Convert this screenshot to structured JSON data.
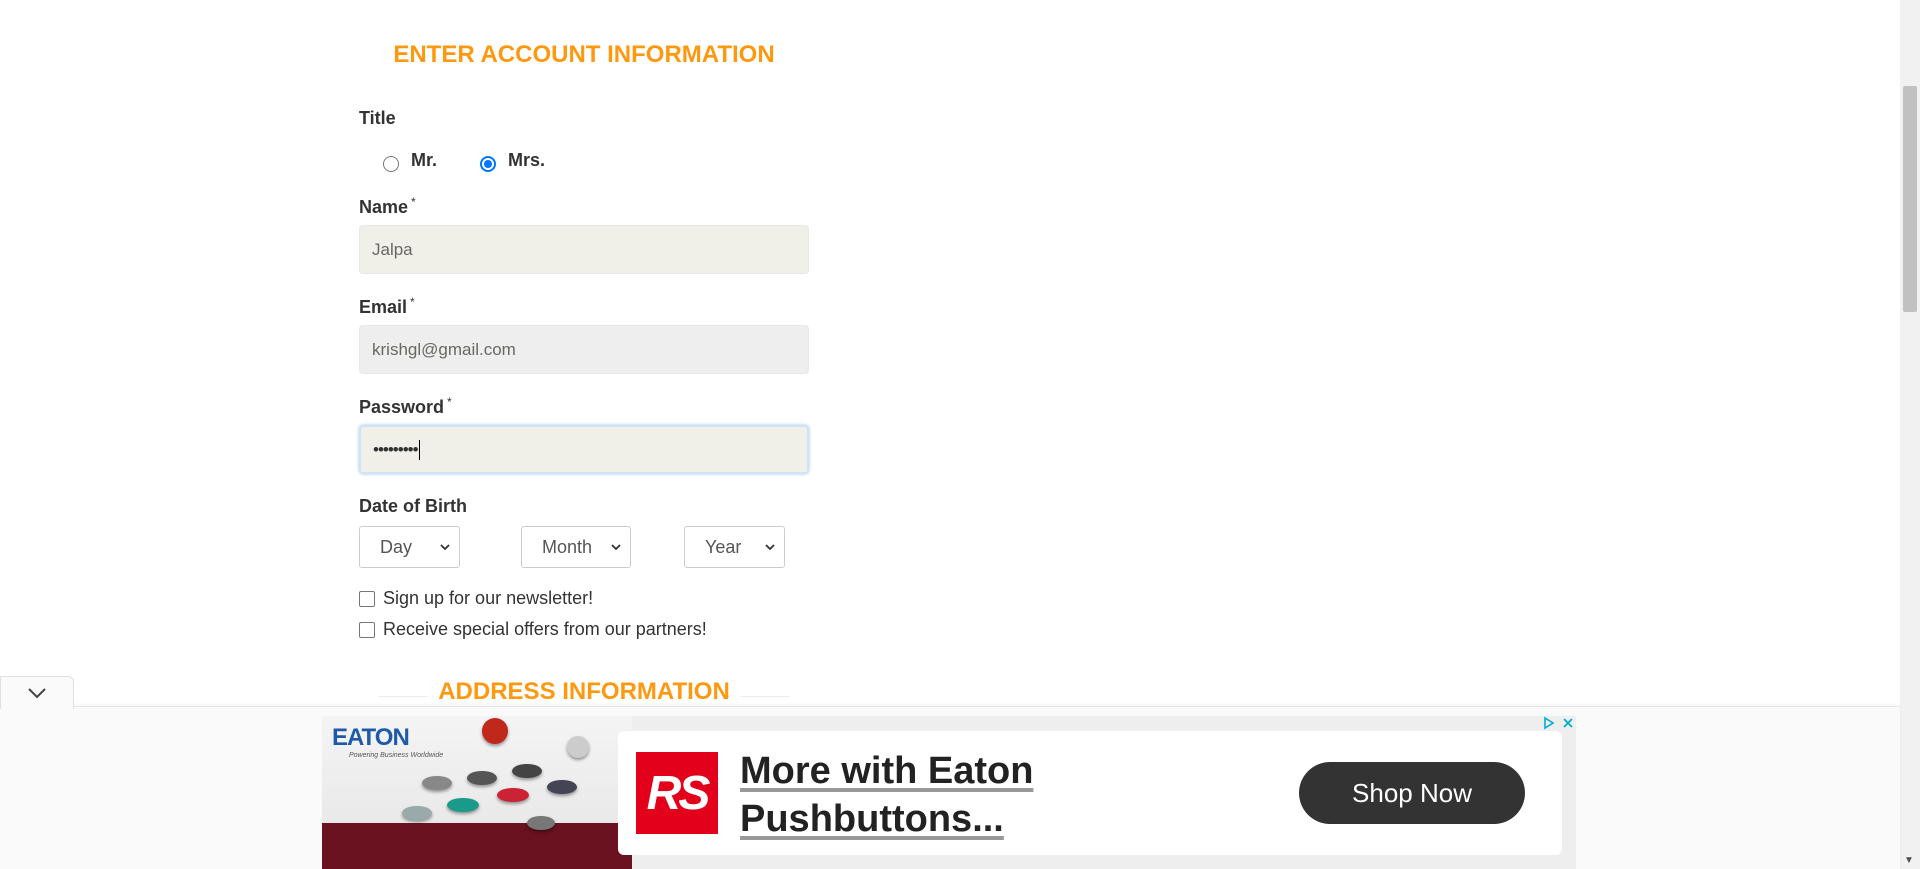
{
  "form": {
    "account_title": "ENTER ACCOUNT INFORMATION",
    "title_label": "Title",
    "title_options": [
      {
        "label": "Mr.",
        "checked": false
      },
      {
        "label": "Mrs.",
        "checked": true
      }
    ],
    "name_label": "Name",
    "name_value": "Jalpa",
    "email_label": "Email",
    "email_value": "krishgl@gmail.com",
    "password_label": "Password",
    "password_value": "•••••••••",
    "required_marker": "*",
    "dob_label": "Date of Birth",
    "dob_day": "Day",
    "dob_month": "Month",
    "dob_year": "Year",
    "newsletter_label": "Sign up for our newsletter!",
    "offers_label": "Receive special offers from our partners!",
    "address_title": "ADDRESS INFORMATION"
  },
  "ad": {
    "brand": "EATON",
    "brand_tagline": "Powering Business Worldwide",
    "logo_text": "RS",
    "headline_line1": "More with Eaton",
    "headline_line2": "Pushbuttons...",
    "cta": "Shop Now",
    "choices_icon": "adchoices-play-icon",
    "close_icon": "close-icon",
    "collapse_icon": "chevron-down-icon"
  },
  "colors": {
    "accent": "#fe980f",
    "radio_checked": "#0075ff",
    "cta_bg": "#333333",
    "rs_red": "#e2001a"
  }
}
